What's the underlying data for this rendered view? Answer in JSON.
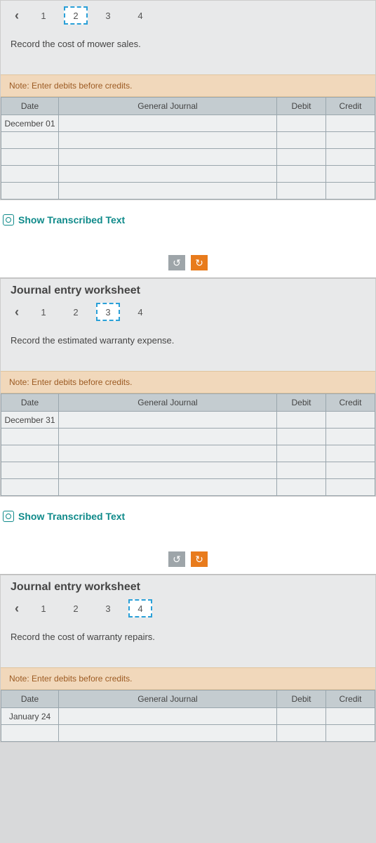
{
  "worksheet1": {
    "tabs": [
      "1",
      "2",
      "3",
      "4"
    ],
    "active_tab_index": 1,
    "prompt": "Record the cost of mower sales.",
    "note": "Note: Enter debits before credits.",
    "headers": {
      "date": "Date",
      "gj": "General Journal",
      "debit": "Debit",
      "credit": "Credit"
    },
    "rows": [
      {
        "date": "December 01"
      },
      {
        "date": ""
      },
      {
        "date": ""
      },
      {
        "date": ""
      },
      {
        "date": ""
      }
    ]
  },
  "show_text": "Show Transcribed Text",
  "toolbar": {
    "undo": "↺",
    "redo": "↻"
  },
  "worksheet2": {
    "title": "Journal entry worksheet",
    "tabs": [
      "1",
      "2",
      "3",
      "4"
    ],
    "active_tab_index": 2,
    "prompt": "Record the estimated warranty expense.",
    "note": "Note: Enter debits before credits.",
    "headers": {
      "date": "Date",
      "gj": "General Journal",
      "debit": "Debit",
      "credit": "Credit"
    },
    "rows": [
      {
        "date": "December 31"
      },
      {
        "date": ""
      },
      {
        "date": ""
      },
      {
        "date": ""
      },
      {
        "date": ""
      }
    ]
  },
  "worksheet3": {
    "title": "Journal entry worksheet",
    "tabs": [
      "1",
      "2",
      "3",
      "4"
    ],
    "active_tab_index": 3,
    "prompt": "Record the cost of warranty repairs.",
    "note": "Note: Enter debits before credits.",
    "headers": {
      "date": "Date",
      "gj": "General Journal",
      "debit": "Debit",
      "credit": "Credit"
    },
    "rows": [
      {
        "date": "January 24"
      },
      {
        "date": ""
      }
    ]
  }
}
